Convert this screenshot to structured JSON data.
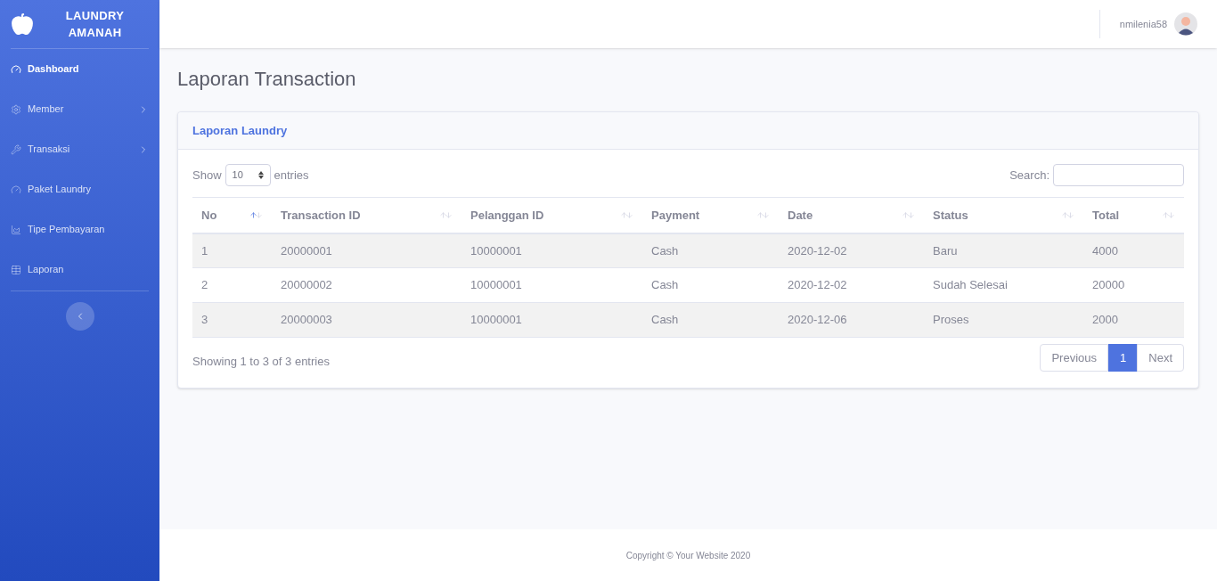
{
  "brand": {
    "name": "LAUNDRY AMANAH"
  },
  "sidebar": {
    "items": [
      {
        "label": "Dashboard",
        "selected": true,
        "has_submenu": false
      },
      {
        "label": "Member",
        "selected": false,
        "has_submenu": true
      },
      {
        "label": "Transaksi",
        "selected": false,
        "has_submenu": true
      },
      {
        "label": "Paket Laundry",
        "selected": false,
        "has_submenu": false
      },
      {
        "label": "Tipe Pembayaran",
        "selected": false,
        "has_submenu": false
      },
      {
        "label": "Laporan",
        "selected": false,
        "has_submenu": false
      }
    ]
  },
  "topbar": {
    "username": "nmilenia58"
  },
  "page_title": "Laporan Transaction",
  "card": {
    "title": "Laporan Laundry",
    "length": {
      "prefix": "Show",
      "value": "10",
      "suffix": "entries"
    },
    "search": {
      "label": "Search:"
    },
    "table": {
      "columns": [
        {
          "label": "No",
          "sorted": true
        },
        {
          "label": "Transaction ID",
          "sorted": false
        },
        {
          "label": "Pelanggan ID",
          "sorted": false
        },
        {
          "label": "Payment",
          "sorted": false
        },
        {
          "label": "Date",
          "sorted": false
        },
        {
          "label": "Status",
          "sorted": false
        },
        {
          "label": "Total",
          "sorted": false
        }
      ],
      "rows": [
        [
          "1",
          "20000001",
          "10000001",
          "Cash",
          "2020-12-02",
          "Baru",
          "4000"
        ],
        [
          "2",
          "20000002",
          "10000001",
          "Cash",
          "2020-12-02",
          "Sudah Selesai",
          "20000"
        ],
        [
          "3",
          "20000003",
          "10000001",
          "Cash",
          "2020-12-06",
          "Proses",
          "2000"
        ]
      ]
    },
    "info": "Showing 1 to 3 of 3 entries",
    "pagination": [
      {
        "label": "Previous",
        "selected": false
      },
      {
        "label": "1",
        "selected": true
      },
      {
        "label": "Next",
        "selected": false
      }
    ]
  },
  "footer": "Copyright © Your Website 2020"
}
